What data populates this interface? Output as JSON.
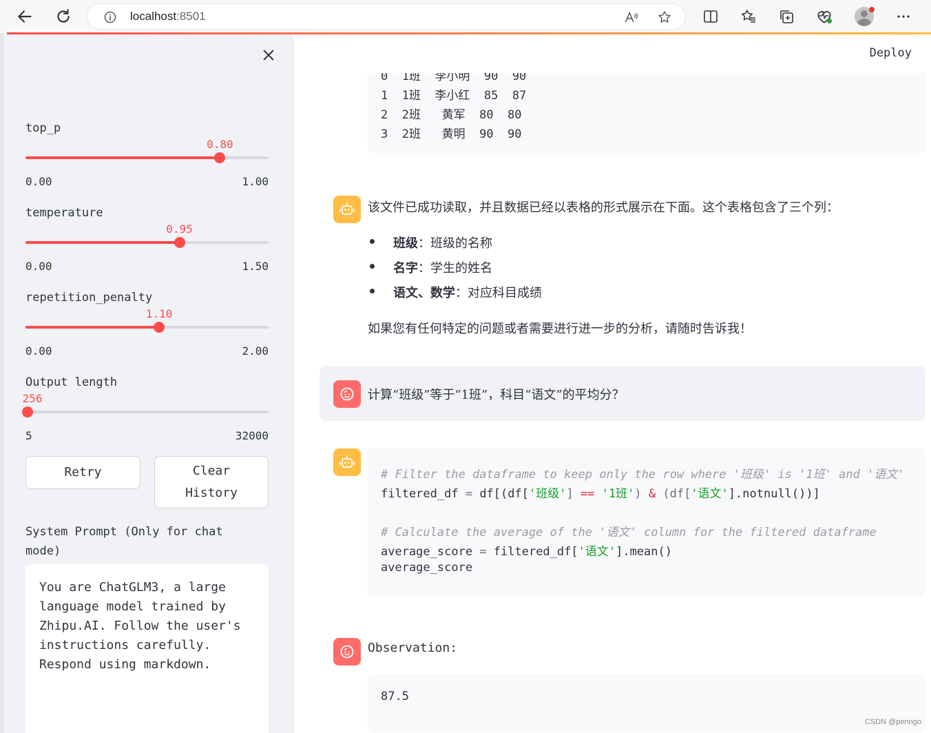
{
  "browser": {
    "url_host": "localhost",
    "url_port": ":8501"
  },
  "sidebar": {
    "sliders": [
      {
        "label": "top_p",
        "value": "0.80",
        "min": "0.00",
        "max": "1.00",
        "fraction": 0.8
      },
      {
        "label": "temperature",
        "value": "0.95",
        "min": "0.00",
        "max": "1.50",
        "fraction": 0.6333
      },
      {
        "label": "repetition_penalty",
        "value": "1.10",
        "min": "0.00",
        "max": "2.00",
        "fraction": 0.55
      },
      {
        "label": "Output length",
        "value": "256",
        "min": "5",
        "max": "32000",
        "fraction": 0.0079
      }
    ],
    "retry_label": "Retry",
    "clear_label": "Clear History",
    "system_prompt_label": "System Prompt (Only for chat mode)",
    "system_prompt_value": "You are ChatGLM3, a large language model trained by Zhipu.AI. Follow the user's instructions carefully. Respond using markdown."
  },
  "header": {
    "deploy_label": "Deploy"
  },
  "main": {
    "dataframe_rows": [
      "0  1班  李小明  90  90",
      "1  1班  李小红  85  87",
      "2  2班   黄军  80  80",
      "3  2班   黄明  90  90"
    ],
    "assistant_intro": "该文件已成功读取，并且数据已经以表格的形式展示在下面。这个表格包含了三个列：",
    "bullets": [
      {
        "term": "班级",
        "desc": "：班级的名称"
      },
      {
        "term": "名字",
        "desc": "：学生的姓名"
      },
      {
        "term": "语文、数学",
        "desc": "：对应科目成绩"
      }
    ],
    "assistant_outro": "如果您有任何特定的问题或者需要进行进一步的分析，请随时告诉我！",
    "user_question": "计算“班级”等于“1班”，科目“语文”的平均分？",
    "code": {
      "comment1": "# Filter the dataframe to keep only the row where '班级' is '1班' and '语文'",
      "line2_a": "filtered_df",
      "line2_b": " = ",
      "line2_c": "df[(df[",
      "line2_d": "'班级'",
      "line2_e": "] ",
      "line2_f": "==",
      "line2_g": " ",
      "line2_h": "'1班'",
      "line2_i": ") ",
      "line2_j": "&",
      "line2_k": " (df[",
      "line2_l": "'语文'",
      "line2_m": "].notnull())]",
      "comment2": "# Calculate the average of the '语文' column for the filtered dataframe",
      "line5_a": "average_score",
      "line5_b": " = ",
      "line5_c": "filtered_df[",
      "line5_d": "'语文'",
      "line5_e": "].mean()",
      "line6": "average_score"
    },
    "observation_label": "Observation:",
    "observation_value": "87.5"
  },
  "watermark": "CSDN @penngo"
}
